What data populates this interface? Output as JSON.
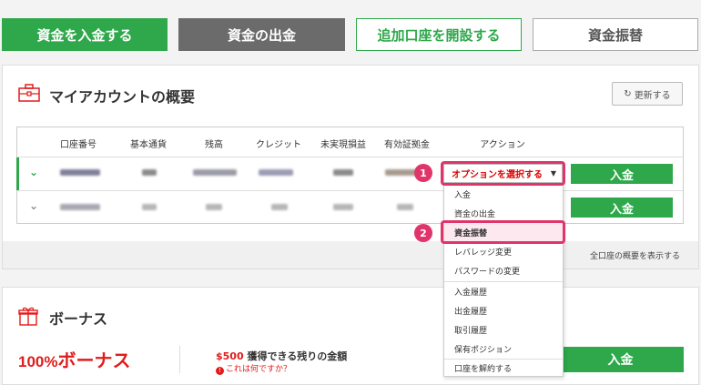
{
  "top_buttons": {
    "deposit": "資金を入金する",
    "withdraw": "資金の出金",
    "open_account": "追加口座を開設する",
    "transfer": "資金振替"
  },
  "account_panel": {
    "title": "マイアカウントの概要",
    "refresh": "更新する",
    "show_all": "全口座の概要を表示する",
    "headers": [
      "口座番号",
      "基本通貨",
      "残高",
      "クレジット",
      "未実現損益",
      "有効証拠金",
      "アクション"
    ],
    "select_placeholder": "オプションを選択する",
    "deposit_btn": "入金",
    "dropdown": [
      "入金",
      "資金の出金",
      "資金振替",
      "レバレッジ変更",
      "パスワードの変更",
      "入金履歴",
      "出金履歴",
      "取引履歴",
      "保有ポジション",
      "口座を解約する"
    ],
    "annotations": [
      "1",
      "2"
    ]
  },
  "bonus_panel": {
    "title": "ボーナス",
    "big_pct": "100%",
    "big_text": "ボーナス",
    "amount": "$500",
    "amount_text": "獲得できる残りの金額",
    "help": "これは何ですか？",
    "deposit_btn": "入金"
  },
  "colors": {
    "green": "#2ea84a",
    "gray": "#6b6b6b",
    "highlight": "#e0356b",
    "red": "#e31b1b"
  }
}
